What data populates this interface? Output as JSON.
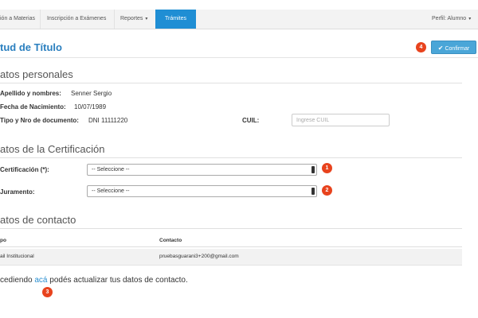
{
  "nav": {
    "items": [
      {
        "label": "ión a Materias"
      },
      {
        "label": "Inscripción a Exámenes"
      },
      {
        "label": "Reportes"
      },
      {
        "label": "Trámites"
      }
    ],
    "profile": "Perfil: Alumno"
  },
  "header": {
    "title": "tud de Título",
    "confirm_label": "Confirmar"
  },
  "badges": [
    "1",
    "2",
    "3",
    "4"
  ],
  "personal": {
    "section_title": "atos personales",
    "name_label": "Apellido y nombres:",
    "name_value": "Senner Sergio",
    "birth_label": "Fecha de Nacimiento:",
    "birth_value": "10/07/1989",
    "doc_label": "Tipo y Nro de documento:",
    "doc_value": "DNI 11111220",
    "cuil_label": "CUIL:",
    "cuil_placeholder": "Ingrese CUIL"
  },
  "certification": {
    "section_title": "atos de la Certificación",
    "cert_label": "Certificación (*):",
    "cert_selected": "-- Seleccione --",
    "oath_label": "Juramento:",
    "oath_selected": "-- Seleccione --"
  },
  "contact": {
    "section_title": "atos de contacto",
    "columns": [
      "po",
      "Contacto"
    ],
    "rows": [
      {
        "type": "ail Institucional",
        "contact": "pruebasguarani3+200@gmail.com"
      }
    ]
  },
  "footer": {
    "prefix": "cediendo ",
    "link": "acá",
    "suffix": " podés actualizar tus datos de contacto."
  },
  "colors": {
    "accent": "#1f8ed4",
    "title": "#2a7fbf",
    "badge": "#e8431d",
    "confirm": "#4aa6d8"
  },
  "icons": {
    "confirm": "check-icon",
    "dropdown": "caret-down-icon"
  }
}
